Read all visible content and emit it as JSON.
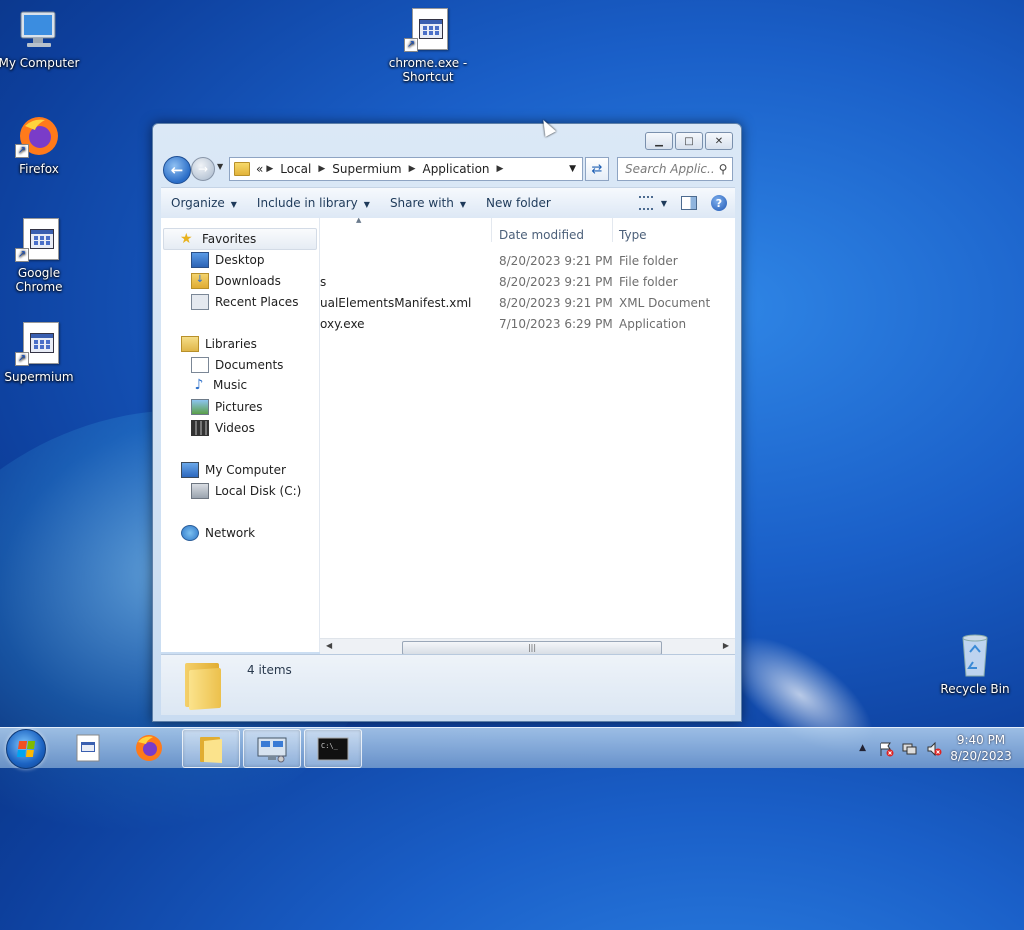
{
  "desktop": {
    "icons": [
      {
        "label": "My Computer",
        "icon": "computer-icon"
      },
      {
        "label": "chrome.exe - Shortcut",
        "icon": "app-shortcut-icon"
      },
      {
        "label": "Firefox",
        "icon": "firefox-icon"
      },
      {
        "label": "Google Chrome",
        "icon": "app-shortcut-icon"
      },
      {
        "label": "Supermium",
        "icon": "app-shortcut-icon"
      },
      {
        "label": "Recycle Bin",
        "icon": "recycle-bin-icon"
      }
    ]
  },
  "explorer": {
    "address": {
      "overflow": "«",
      "crumbs": [
        "Local",
        "Supermium",
        "Application"
      ]
    },
    "search_placeholder": "Search Applic...",
    "toolbar": {
      "organize": "Organize",
      "include_in_library": "Include in library",
      "share_with": "Share with",
      "new_folder": "New folder"
    },
    "nav": {
      "favorites": "Favorites",
      "desktop": "Desktop",
      "downloads": "Downloads",
      "recent_places": "Recent Places",
      "libraries": "Libraries",
      "documents": "Documents",
      "music": "Music",
      "pictures": "Pictures",
      "videos": "Videos",
      "my_computer": "My Computer",
      "local_disk": "Local Disk (C:)",
      "network": "Network"
    },
    "columns": {
      "date": "Date modified",
      "type": "Type"
    },
    "files": [
      {
        "name": "",
        "date": "8/20/2023 9:21 PM",
        "type": "File folder"
      },
      {
        "name": "s",
        "date": "8/20/2023 9:21 PM",
        "type": "File folder"
      },
      {
        "name": "ualElementsManifest.xml",
        "date": "8/20/2023 9:21 PM",
        "type": "XML Document"
      },
      {
        "name": "oxy.exe",
        "date": "7/10/2023 6:29 PM",
        "type": "Application"
      }
    ],
    "item_count": "4 items"
  },
  "taskbar": {
    "time": "9:40 PM",
    "date": "8/20/2023"
  }
}
